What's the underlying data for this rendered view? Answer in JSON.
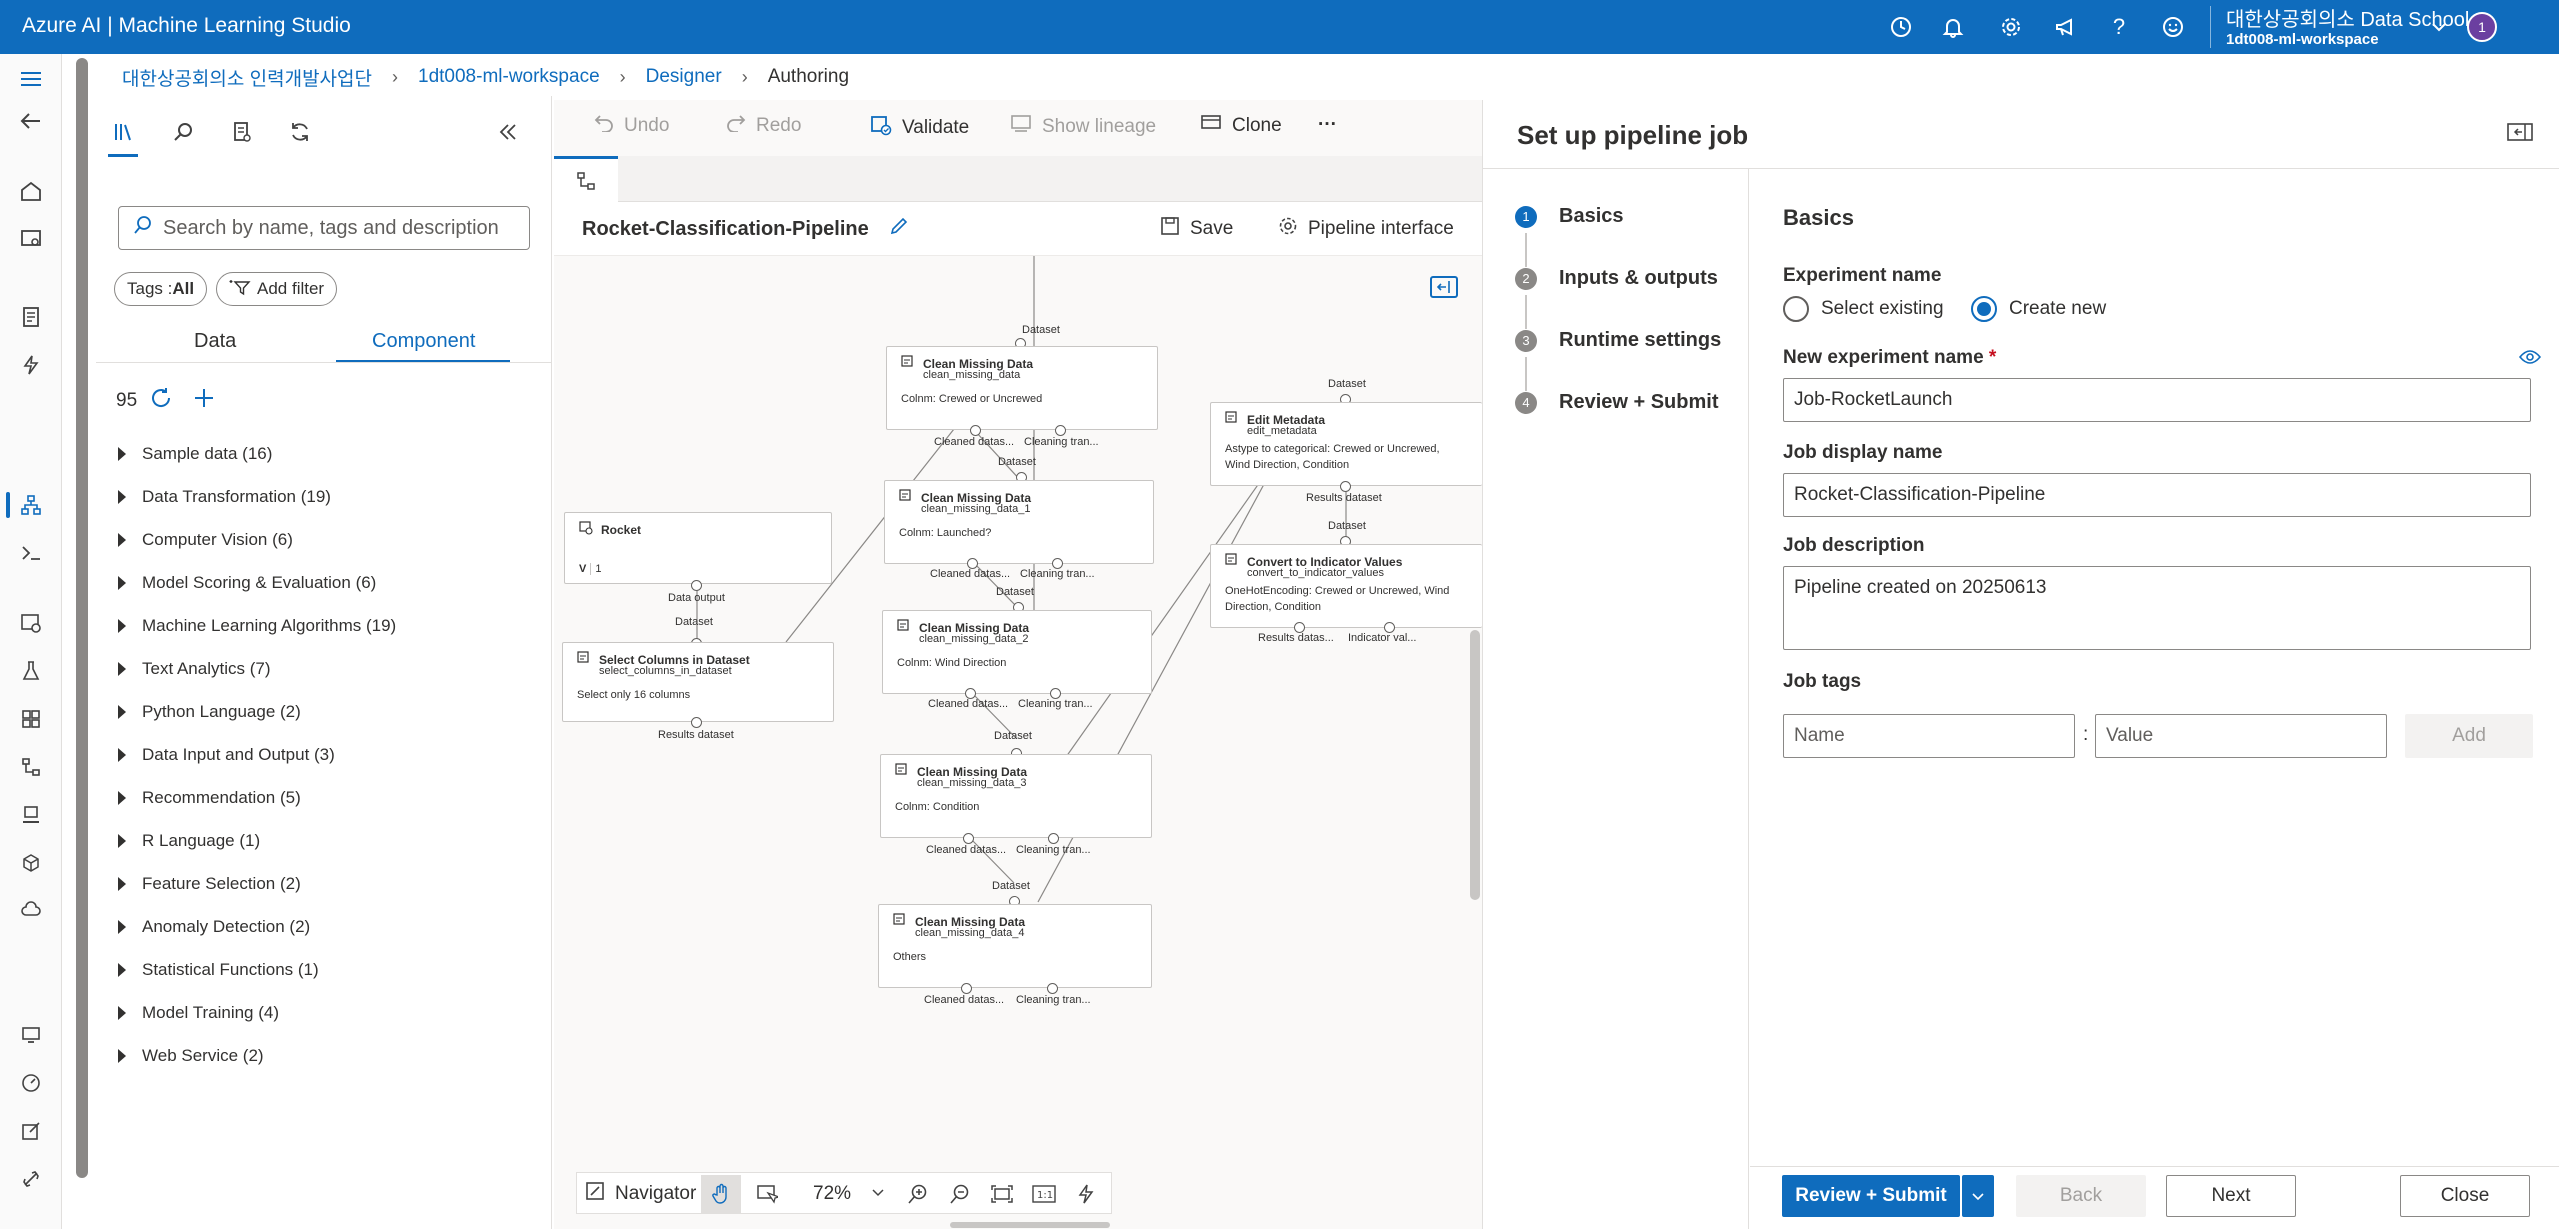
{
  "topbar": {
    "title": "Azure AI | Machine Learning Studio",
    "org": "대한상공회의소 Data School",
    "workspace": "1dt008-ml-workspace",
    "avatar": "1",
    "icons": [
      "clock-icon",
      "bell-icon",
      "gear-icon",
      "megaphone-icon",
      "help-icon",
      "smiley-icon",
      "chevron-down-icon"
    ]
  },
  "breadcrumb": {
    "items": [
      "대한상공회의소 인력개발사업단",
      "1dt008-ml-workspace",
      "Designer"
    ],
    "current": "Authoring"
  },
  "assets": {
    "search_placeholder": "Search by name, tags and description",
    "tags_label": "Tags : ",
    "tags_value": "All",
    "add_filter": "Add filter",
    "tab_data": "Data",
    "tab_component": "Component",
    "count": "95",
    "categories": [
      "Sample data (16)",
      "Data Transformation (19)",
      "Computer Vision (6)",
      "Model Scoring & Evaluation (6)",
      "Machine Learning Algorithms (19)",
      "Text Analytics (7)",
      "Python Language (2)",
      "Data Input and Output (3)",
      "Recommendation (5)",
      "R Language (1)",
      "Feature Selection (2)",
      "Anomaly Detection (2)",
      "Statistical Functions (1)",
      "Model Training (4)",
      "Web Service (2)"
    ]
  },
  "toolbar": {
    "undo": "Undo",
    "redo": "Redo",
    "validate": "Validate",
    "show_lineage": "Show lineage",
    "clone": "Clone",
    "more": "···"
  },
  "pipeline": {
    "name": "Rocket-Classification-Pipeline",
    "save": "Save",
    "interface": "Pipeline interface"
  },
  "nodes": {
    "rocket": {
      "title": "Rocket",
      "version": "V",
      "version_num": "1",
      "out": "Data output"
    },
    "select": {
      "in": "Dataset",
      "title": "Select Columns in Dataset",
      "sub": "select_columns_in_dataset",
      "desc": "Select only 16 columns",
      "out": "Results dataset"
    },
    "cmd0": {
      "in": "Dataset",
      "title": "Clean Missing Data",
      "sub": "clean_missing_data",
      "desc": "Colnm: Crewed or Uncrewed",
      "out1": "Cleaned datas...",
      "out2": "Cleaning tran..."
    },
    "cmd1": {
      "in": "Dataset",
      "title": "Clean Missing Data",
      "sub": "clean_missing_data_1",
      "desc": "Colnm: Launched?",
      "out1": "Cleaned datas...",
      "out2": "Cleaning tran..."
    },
    "cmd2": {
      "in": "Dataset",
      "title": "Clean Missing Data",
      "sub": "clean_missing_data_2",
      "desc": "Colnm: Wind Direction",
      "out1": "Cleaned datas...",
      "out2": "Cleaning tran..."
    },
    "cmd3": {
      "in": "Dataset",
      "title": "Clean Missing Data",
      "sub": "clean_missing_data_3",
      "desc": "Colnm: Condition",
      "out1": "Cleaned datas...",
      "out2": "Cleaning tran..."
    },
    "cmd4": {
      "in": "Dataset",
      "title": "Clean Missing Data",
      "sub": "clean_missing_data_4",
      "desc": "Others",
      "out1": "Cleaned datas...",
      "out2": "Cleaning tran..."
    },
    "meta": {
      "in": "Dataset",
      "title": "Edit Metadata",
      "sub": "edit_metadata",
      "desc1": "Astype to categorical: Crewed or Uncrewed,",
      "desc2": "Wind Direction, Condition",
      "out": "Results dataset"
    },
    "conv": {
      "in": "Dataset",
      "title": "Convert to Indicator Values",
      "sub": "convert_to_indicator_values",
      "desc1": "OneHotEncoding: Crewed or Uncrewed, Wind",
      "desc2": "Direction, Condition",
      "out1": "Results datas...",
      "out2": "Indicator val..."
    }
  },
  "navigator": {
    "label": "Navigator",
    "zoom": "72%"
  },
  "setup": {
    "title": "Set up pipeline job",
    "steps": [
      {
        "num": "1",
        "label": "Basics"
      },
      {
        "num": "2",
        "label": "Inputs & outputs"
      },
      {
        "num": "3",
        "label": "Runtime settings"
      },
      {
        "num": "4",
        "label": "Review + Submit"
      }
    ],
    "section": "Basics",
    "experiment_name": "Experiment name",
    "select_existing": "Select existing",
    "create_new": "Create new",
    "new_experiment_name": "New experiment name",
    "required": "*",
    "experiment_value": "Job-RocketLaunch",
    "display_name_label": "Job display name",
    "display_name_value": "Rocket-Classification-Pipeline",
    "description_label": "Job description",
    "description_value": "Pipeline created on 20250613",
    "tags_label": "Job tags",
    "tag_name_placeholder": "Name",
    "tag_value_placeholder": "Value",
    "colon": ":",
    "add": "Add",
    "review_submit": "Review + Submit",
    "back": "Back",
    "next": "Next",
    "close": "Close"
  },
  "colors": {
    "accent": "#0f6cbd",
    "topbar": "#0f6cbd"
  }
}
